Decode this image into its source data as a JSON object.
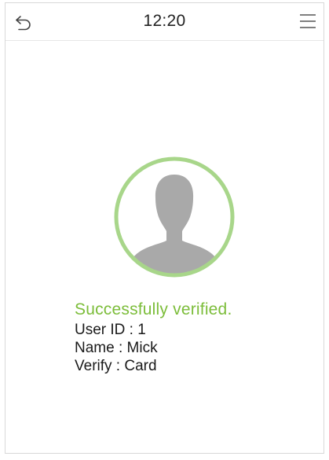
{
  "header": {
    "time": "12:20",
    "back_icon": "back-arrow-icon",
    "menu_icon": "hamburger-menu-icon"
  },
  "avatar": {
    "icon": "user-silhouette-icon",
    "ring_color": "#a8d68a",
    "silhouette_color": "#a9a9a9"
  },
  "result": {
    "title": "Successfully verified.",
    "title_color": "#7cbd3a",
    "user_id": "User ID : 1",
    "name": "Name : Mick",
    "verify": "Verify : Card"
  }
}
